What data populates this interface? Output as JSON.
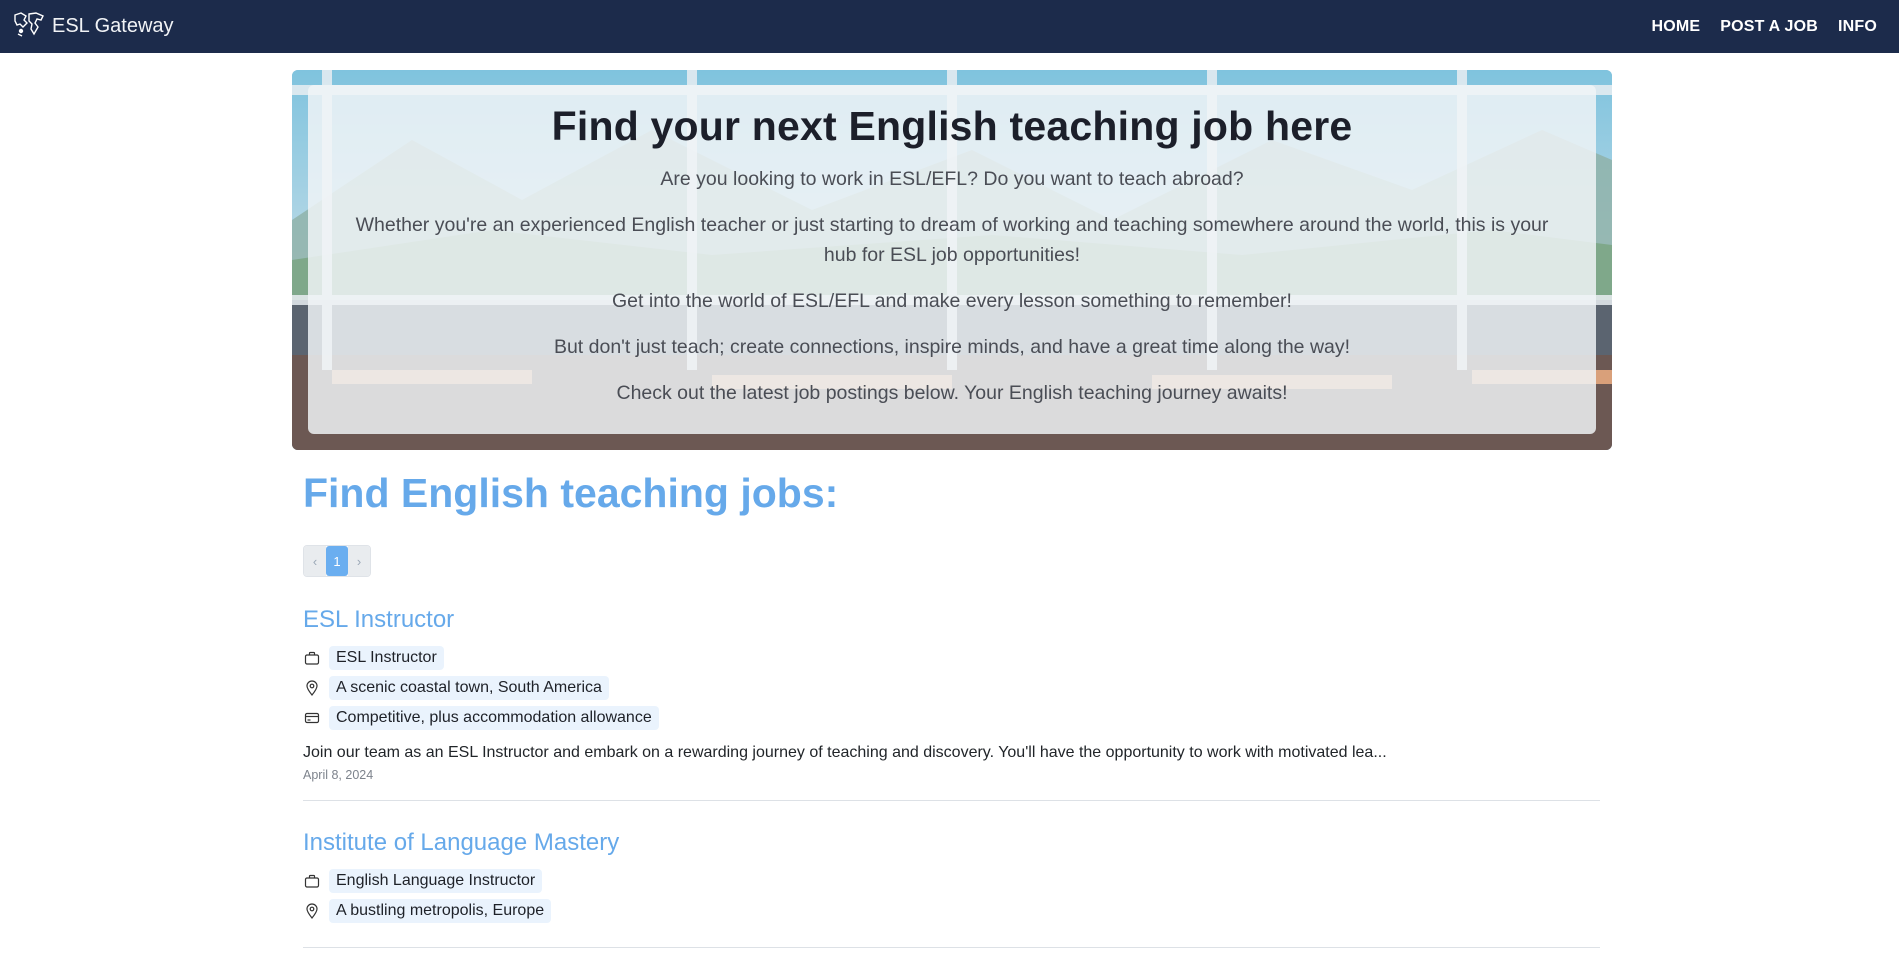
{
  "navbar": {
    "brand": "ESL Gateway",
    "brand_icon": "world-map-icon",
    "links": [
      {
        "label": "HOME"
      },
      {
        "label": "POST A JOB"
      },
      {
        "label": "INFO"
      }
    ],
    "bg_color": "#1c2b4b"
  },
  "hero": {
    "title": "Find your next English teaching job here",
    "paragraphs": [
      "Are you looking to work in ESL/EFL? Do you want to teach abroad?",
      "Whether you're an experienced English teacher or just starting to dream of working and teaching somewhere around the world, this is your hub for ESL job opportunities!",
      "Get into the world of ESL/EFL and make every lesson something to remember!",
      "But don't just teach; create connections, inspire minds, and have a great time along the way!",
      "Check out the latest job postings below. Your English teaching journey awaits!"
    ]
  },
  "section": {
    "title": "Find English teaching jobs:",
    "accent_color": "#66a9ea"
  },
  "pagination": {
    "prev": "‹",
    "current": "1",
    "next": "›"
  },
  "jobs": [
    {
      "title": "ESL Instructor",
      "position": "ESL Instructor",
      "location": "A scenic coastal town, South America",
      "salary": "Competitive, plus accommodation allowance",
      "description": "Join our team as an ESL Instructor and embark on a rewarding journey of teaching and discovery. You'll have the opportunity to work with motivated lea...",
      "date": "April 8, 2024"
    },
    {
      "title": "Institute of Language Mastery",
      "position": "English Language Instructor",
      "location": "A bustling metropolis, Europe"
    }
  ]
}
